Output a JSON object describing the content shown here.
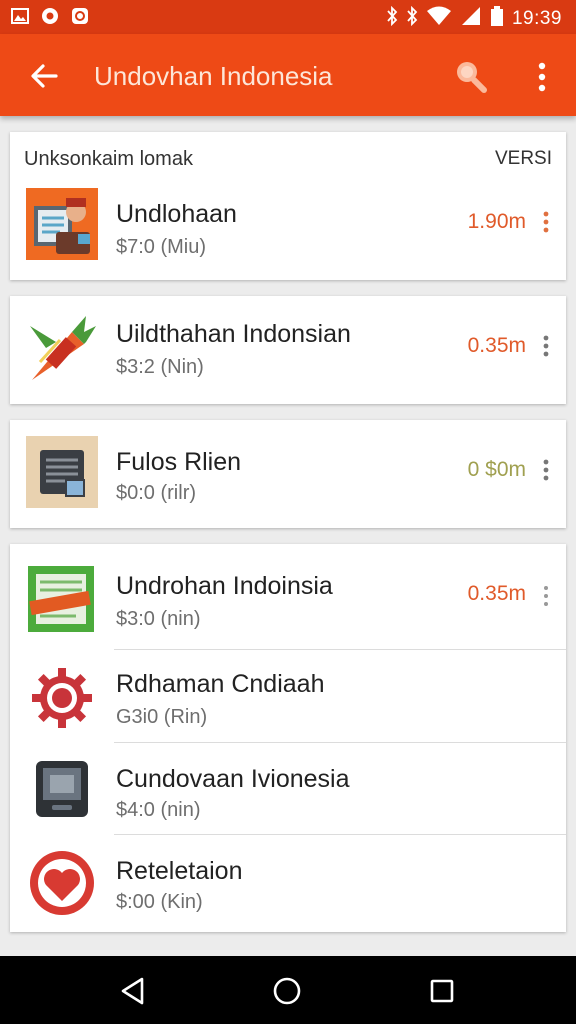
{
  "status_bar": {
    "time": "19:39",
    "left_icons": [
      "gallery-icon",
      "notification-icon",
      "app-icon"
    ],
    "right_icons": [
      "bluetooth-icon",
      "vibrate-icon",
      "wifi-icon",
      "signal-icon",
      "battery-icon"
    ]
  },
  "app_bar": {
    "title": "Undovhan Indonesia",
    "color": "#ee4a16"
  },
  "section": {
    "header": "Unksonkaim lomak",
    "version_label": "VERSI"
  },
  "apps": [
    {
      "name": "Undlohaan",
      "price": "$7:0 (Miu)",
      "size": "1.90m",
      "size_color": "#e05a2a",
      "icon": "briefcase-icon"
    },
    {
      "name": "Uildthahan Indonsian",
      "price": "$3:2 (Nin)",
      "size": "0.35m",
      "size_color": "#e05a2a",
      "icon": "carrot-icon"
    },
    {
      "name": "Fulos Rlien",
      "price": "$0:0 (rilr)",
      "size": "0 $0m",
      "size_color": "#a0a050",
      "icon": "document-icon"
    },
    {
      "name": "Undrohan Indoinsia",
      "price": "$3:0 (nin)",
      "size": "0.35m",
      "size_color": "#e05a2a",
      "icon": "ticket-icon"
    },
    {
      "name": "Rdhaman Cndiaah",
      "price": "G3i0 (Rin)",
      "icon": "gear-icon"
    },
    {
      "name": "Cundovaan Ivionesia",
      "price": "$4:0 (nin)",
      "icon": "device-icon"
    },
    {
      "name": "Reteletaion",
      "price": "$:00 (Kin)",
      "icon": "heart-icon"
    }
  ],
  "nav_bar": {
    "buttons": [
      "back-icon",
      "home-icon",
      "recents-icon"
    ]
  }
}
